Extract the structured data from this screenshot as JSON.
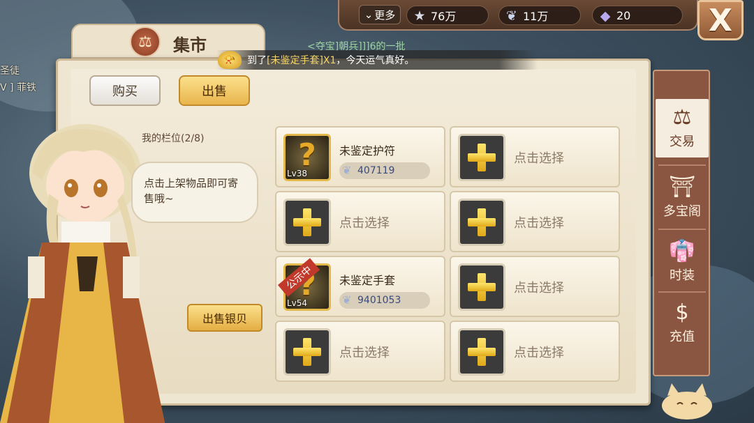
{
  "topbar": {
    "more_label": "更多",
    "stars": "76万",
    "shells": "11万",
    "gems": "20",
    "close_label": "X"
  },
  "panel": {
    "title": "集市",
    "tabs": {
      "buy": "购买",
      "sell": "出售"
    },
    "slots_label": "我的栏位(2/8)",
    "speech": "点击上架物品即可寄售哦~",
    "sell_silver": "出售银贝"
  },
  "notice": {
    "top_line": "<夺宝]朝兵]]]6的一批",
    "prefix": "到了",
    "item": "[未鉴定手套]X1",
    "suffix": "，今天运气真好。"
  },
  "left_overlay": {
    "line1": "圣徒",
    "line2": "V ] 菲铁"
  },
  "slots": [
    {
      "type": "item",
      "name": "未鉴定护符",
      "level": "Lv38",
      "price": "407119",
      "public": ""
    },
    {
      "type": "empty",
      "label": "点击选择"
    },
    {
      "type": "empty",
      "label": "点击选择"
    },
    {
      "type": "empty",
      "label": "点击选择"
    },
    {
      "type": "item",
      "name": "未鉴定手套",
      "level": "Lv54",
      "price": "9401053",
      "public": "公示中"
    },
    {
      "type": "empty",
      "label": "点击选择"
    },
    {
      "type": "empty",
      "label": "点击选择"
    },
    {
      "type": "empty",
      "label": "点击选择"
    }
  ],
  "sidenav": [
    {
      "label": "交易",
      "icon": "scale-icon"
    },
    {
      "label": "多宝阁",
      "icon": "treasure-icon"
    },
    {
      "label": "时装",
      "icon": "clothes-icon"
    },
    {
      "label": "充值",
      "icon": "dollar-icon"
    }
  ],
  "colors": {
    "accent": "#e9b54d",
    "frame": "#8a5642",
    "panel": "#efe6d2"
  }
}
